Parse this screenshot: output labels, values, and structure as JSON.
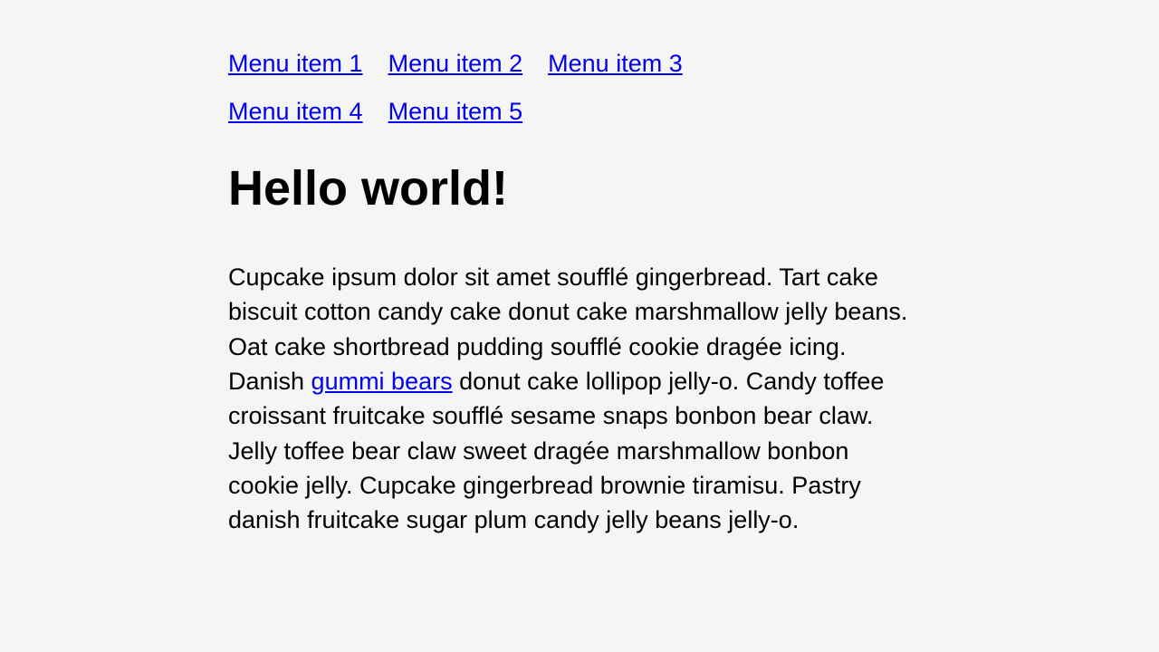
{
  "nav": {
    "items": [
      {
        "label": "Menu item 1"
      },
      {
        "label": "Menu item 2"
      },
      {
        "label": "Menu item 3"
      },
      {
        "label": "Menu item 4"
      },
      {
        "label": "Menu item 5"
      }
    ]
  },
  "heading": "Hello world!",
  "paragraph": {
    "part1": "Cupcake ipsum dolor sit amet soufflé gingerbread. Tart cake biscuit cotton candy cake donut cake marshmallow jelly beans. Oat cake shortbread pudding soufflé cookie dragée icing. Danish ",
    "link_text": "gummi bears",
    "part2": " donut cake lollipop jelly-o. Candy toffee croissant fruitcake soufflé sesame snaps bonbon bear claw. Jelly toffee bear claw sweet dragée marshmallow bonbon cookie jelly. Cupcake gingerbread brownie tiramisu. Pastry danish fruitcake sugar plum candy jelly beans jelly-o."
  }
}
